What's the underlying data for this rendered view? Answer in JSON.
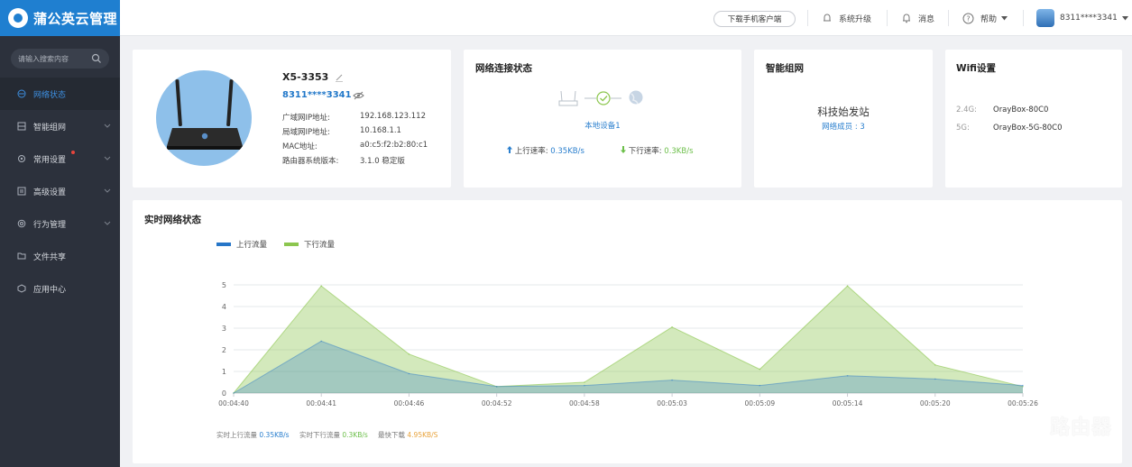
{
  "sidebar": {
    "logo_text": "蒲公英云管理",
    "search_placeholder": "请输入搜索内容",
    "items": [
      {
        "label": "网络状态",
        "icon": "network-status-icon",
        "active": true
      },
      {
        "label": "智能组网",
        "icon": "mesh-network-icon",
        "has_chevron": true
      },
      {
        "label": "常用设置",
        "icon": "gear-icon",
        "has_chevron": true,
        "badge_dot": true
      },
      {
        "label": "高级设置",
        "icon": "advanced-settings-icon",
        "has_chevron": true
      },
      {
        "label": "行为管理",
        "icon": "behavior-management-icon",
        "has_chevron": true
      },
      {
        "label": "文件共享",
        "icon": "folder-icon"
      },
      {
        "label": "应用中心",
        "icon": "app-center-icon"
      }
    ]
  },
  "topbar": {
    "download_label": "下载手机客户端",
    "upgrade_label": "系统升级",
    "messages_label": "消息",
    "help_label": "帮助",
    "account_label": "8311****3341"
  },
  "device": {
    "name": "X5-3353",
    "account": "8311****3341",
    "rows": [
      {
        "label": "广域网IP地址:",
        "value": "192.168.123.112"
      },
      {
        "label": "局域网IP地址:",
        "value": "10.168.1.1"
      },
      {
        "label": "MAC地址:",
        "value": "a0:c5:f2:b2:80:c1"
      },
      {
        "label": "路由器系统版本:",
        "value": "3.1.0 稳定版"
      }
    ]
  },
  "net_status": {
    "title": "网络连接状态",
    "local_device": "本地设备1",
    "up_label": "上行速率:",
    "up_value": "0.35KB/s",
    "down_label": "下行速率:",
    "down_value": "0.3KB/s"
  },
  "mesh": {
    "title": "智能组网",
    "station": "科技始发站",
    "members": "网络成员 : 3"
  },
  "wifi": {
    "title": "Wifi设置",
    "bands": [
      {
        "band": "2.4G:",
        "ssid": "OrayBox-80C0"
      },
      {
        "band": "5G:",
        "ssid": "OrayBox-5G-80C0"
      }
    ]
  },
  "chart_section": {
    "title": "实时网络状态",
    "footer": {
      "up_label": "实时上行流量",
      "up_value": "0.35KB/s",
      "down_label": "实时下行流量",
      "down_value": "0.3KB/s",
      "max_label": "最快下载",
      "max_value": "4.95KB/S"
    }
  },
  "chart_data": {
    "type": "area",
    "x": [
      "00:04:40",
      "00:04:41",
      "00:04:46",
      "00:04:52",
      "00:04:58",
      "00:05:03",
      "00:05:09",
      "00:05:14",
      "00:05:20",
      "00:05:26"
    ],
    "series": [
      {
        "name": "上行流量",
        "color": "#2676c8",
        "values": [
          0,
          2.4,
          0.9,
          0.3,
          0.35,
          0.6,
          0.35,
          0.8,
          0.65,
          0.35
        ]
      },
      {
        "name": "下行流量",
        "color": "#8cc64f",
        "values": [
          0,
          4.95,
          1.8,
          0.3,
          0.5,
          3.05,
          1.1,
          4.95,
          1.3,
          0.3
        ]
      }
    ],
    "yticks": [
      0,
      1,
      2,
      3,
      4,
      5
    ],
    "ylim": [
      0,
      5
    ],
    "grid": true,
    "legend_position": "top-left"
  },
  "watermark": {
    "text": "路由器",
    "url": "luyouqi.com"
  }
}
